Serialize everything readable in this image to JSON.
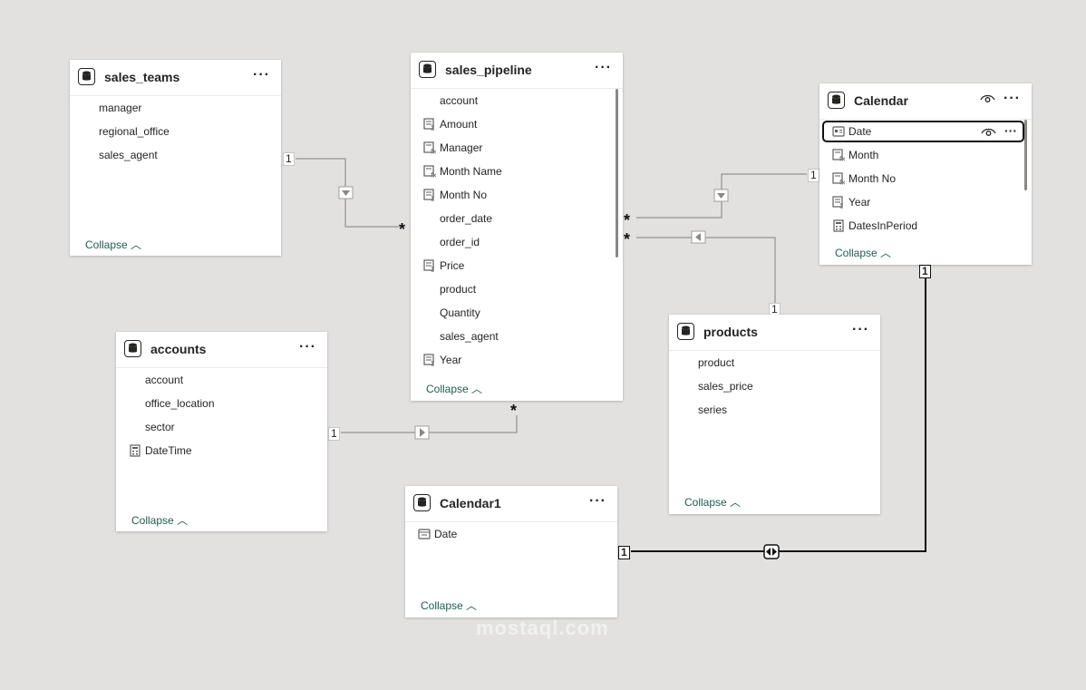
{
  "icons": {
    "table": "table-icon",
    "column": "none",
    "measure": "measure-icon",
    "calc_column": "calculated-column-icon",
    "calendar": "calendar-table-icon",
    "date": "date-field-icon",
    "more": "more-options-icon",
    "visibility": "eye-icon"
  },
  "tables": {
    "sales_teams": {
      "title": "sales_teams",
      "fields": [
        {
          "label": "manager"
        },
        {
          "label": "regional_office"
        },
        {
          "label": "sales_agent"
        }
      ],
      "collapse": "Collapse"
    },
    "sales_pipeline": {
      "title": "sales_pipeline",
      "fields": [
        {
          "label": "account"
        },
        {
          "label": "Amount"
        },
        {
          "label": "Manager"
        },
        {
          "label": "Month Name"
        },
        {
          "label": "Month No"
        },
        {
          "label": "order_date"
        },
        {
          "label": "order_id"
        },
        {
          "label": "Price"
        },
        {
          "label": "product"
        },
        {
          "label": "Quantity"
        },
        {
          "label": "sales_agent"
        },
        {
          "label": "Year"
        }
      ],
      "collapse": "Collapse"
    },
    "calendar": {
      "title": "Calendar",
      "fields": [
        {
          "label": "Date"
        },
        {
          "label": "Month"
        },
        {
          "label": "Month No"
        },
        {
          "label": "Year"
        },
        {
          "label": "DatesInPeriod"
        }
      ],
      "collapse": "Collapse"
    },
    "accounts": {
      "title": "accounts",
      "fields": [
        {
          "label": "account"
        },
        {
          "label": "office_location"
        },
        {
          "label": "sector"
        },
        {
          "label": "DateTime"
        }
      ],
      "collapse": "Collapse"
    },
    "products": {
      "title": "products",
      "fields": [
        {
          "label": "product"
        },
        {
          "label": "sales_price"
        },
        {
          "label": "series"
        }
      ],
      "collapse": "Collapse"
    },
    "calendar1": {
      "title": "Calendar1",
      "fields": [
        {
          "label": "Date"
        }
      ],
      "collapse": "Collapse"
    }
  },
  "relationships": {
    "one": "1",
    "many": "*"
  },
  "watermark": "mostaql.com",
  "more_symbol": "···",
  "collapse_caret": "^"
}
